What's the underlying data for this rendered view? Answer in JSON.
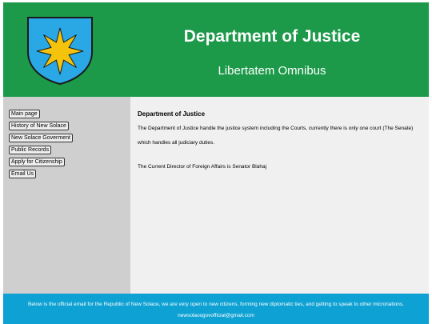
{
  "header": {
    "title": "Department of Justice",
    "motto": "Libertatem Omnibus",
    "background_color": "#1c9a4a",
    "logo": {
      "icon": "star-shield-icon",
      "shield_color": "#2aa8e6",
      "star_color": "#f5c30c"
    }
  },
  "sidebar": {
    "items": [
      {
        "label": "Main page"
      },
      {
        "label": "History of New Solace"
      },
      {
        "label": "New Solace Goverment"
      },
      {
        "label": "Public Records"
      },
      {
        "label": "Apply for Citizenship"
      },
      {
        "label": "Email Us"
      }
    ]
  },
  "main": {
    "title": "Department of Justice",
    "paragraph_1": "The Department of Justice handle the justice system including the Courts, currently there is only one court (The Senate)",
    "paragraph_2": "which handles all judiciary duties.",
    "paragraph_3": "The Current Director of Foreign Affairs is Senator Blahaj"
  },
  "footer": {
    "text": "Below is the official email for the Republic of New Solace, we are very open to new citizens, forming new diplomatic ties, and getting to speak to other micronations.",
    "email": "newsolacegovofficial@gmail.com",
    "background_color": "#0ea1d3"
  }
}
